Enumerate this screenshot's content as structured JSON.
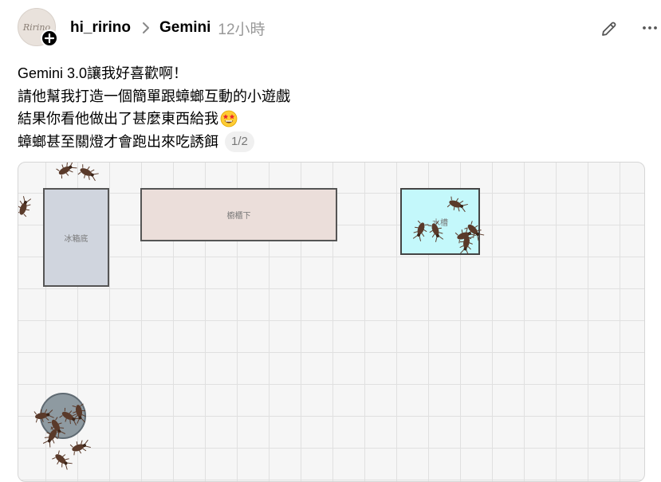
{
  "header": {
    "avatar_text": "Ririno",
    "username": "hi_ririno",
    "topic": "Gemini",
    "time": "12小時"
  },
  "icons": {
    "follow": "plus-icon",
    "separator": "chevron-right-icon",
    "edit": "pencil-icon",
    "more": "ellipsis-icon",
    "emoji": "star-struck-emoji"
  },
  "post": {
    "line1": "Gemini 3.0讓我好喜歡啊！",
    "line2": "請他幫我打造一個簡單跟蟑螂互動的小遊戲",
    "line3": "結果你看他做出了甚麼東西給我",
    "line4": "蟑螂甚至關燈才會跑出來吃誘餌",
    "counter": "1/2"
  },
  "game": {
    "zone_fridge": "冰箱底",
    "zone_cabinet": "櫥櫃下",
    "zone_sink": "水槽"
  },
  "colors": {
    "fridge": "#d0d5de",
    "cabinet": "#ebdeda",
    "sink": "#c4f8fb",
    "trap": "#8e9aa1",
    "roach": "#5a3a2a"
  }
}
